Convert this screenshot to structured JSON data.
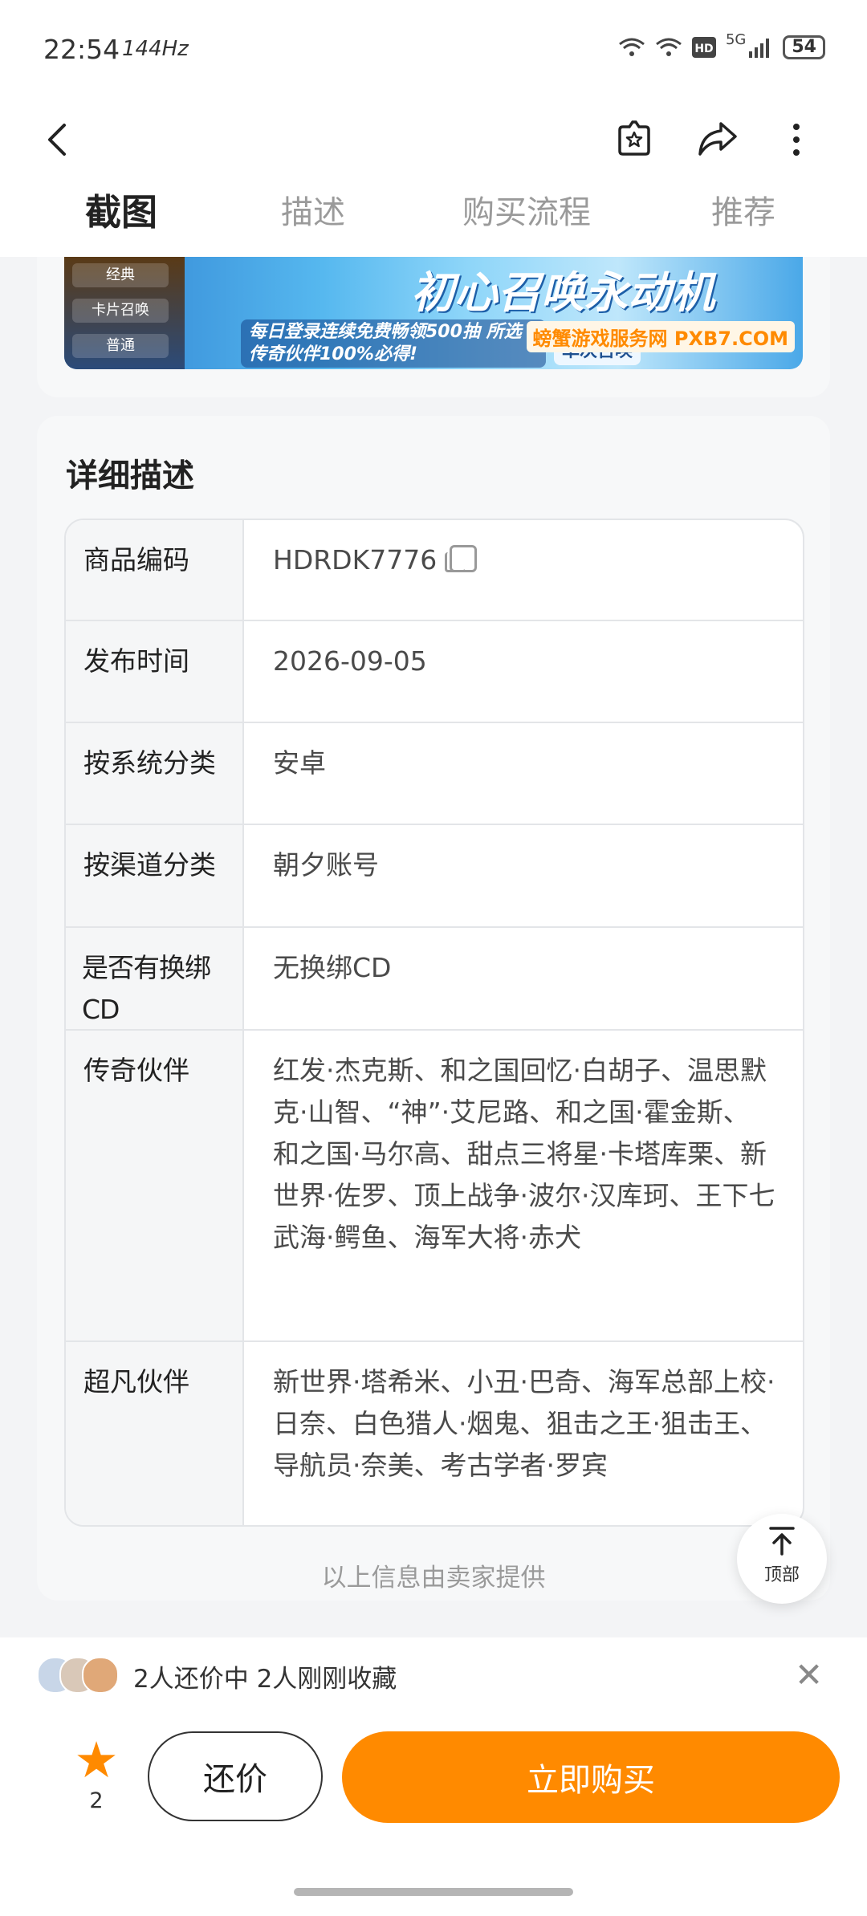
{
  "status_bar": {
    "time": "22:54",
    "refresh": "144Hz",
    "network": "5G",
    "battery": "54"
  },
  "header": {
    "tabs": [
      {
        "label": "截图",
        "active": true
      },
      {
        "label": "描述",
        "active": false
      },
      {
        "label": "购买流程",
        "active": false
      },
      {
        "label": "推荐",
        "active": false
      }
    ]
  },
  "banner": {
    "title": "初心召唤永动机",
    "slogan": "每日登录连续免费畅领500抽 所选传奇伙伴100%必得!",
    "single_summon": "单次召唤",
    "site": "螃蟹游戏服务网 PXB7.COM",
    "chips": [
      "经典",
      "卡片召唤",
      "普通"
    ]
  },
  "detail": {
    "title": "详细描述",
    "rows": [
      {
        "label": "商品编码",
        "value": "HDRDK7776",
        "copy": true
      },
      {
        "label": "发布时间",
        "value": "2026-09-05"
      },
      {
        "label": "按系统分类",
        "value": "安卓"
      },
      {
        "label": "按渠道分类",
        "value": "朝夕账号"
      },
      {
        "label": "是否有换绑CD",
        "value": "无换绑CD"
      },
      {
        "label": "传奇伙伴",
        "value": "红发·杰克斯、和之国回忆·白胡子、温思默克·山智、“神”·艾尼路、和之国·霍金斯、和之国·马尔高、甜点三将星·卡塔库栗、新世界·佐罗、顶上战争·波尔·汉库珂、王下七武海·鳄鱼、海军大将·赤犬"
      },
      {
        "label": "超凡伙伴",
        "value": "新世界·塔希米、小丑·巴奇、海军总部上校·日奈、白色猎人·烟鬼、狙击之王·狙击王、导航员·奈美、考古学者·罗宾"
      }
    ],
    "footnote": "以上信息由卖家提供"
  },
  "to_top": {
    "label": "顶部"
  },
  "bottom_bar": {
    "social_text": "2人还价中  2人刚刚收藏",
    "fav_count": "2",
    "haggle_label": "还价",
    "buy_label": "立即购买"
  },
  "colors": {
    "accent": "#ff8a00",
    "text": "#222222",
    "muted": "#9a9a9a"
  }
}
